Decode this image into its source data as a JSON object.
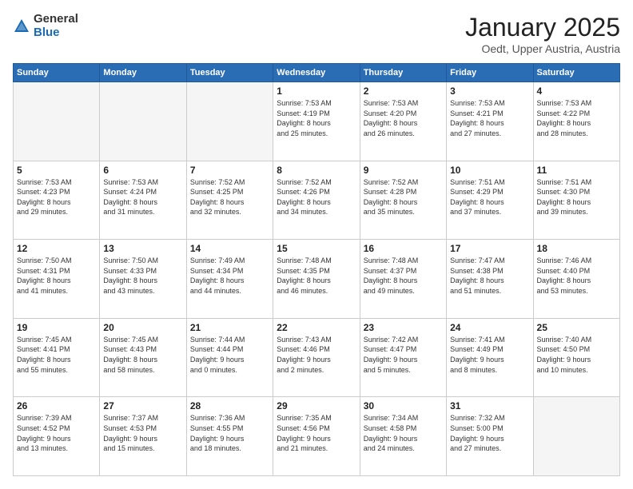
{
  "logo": {
    "general": "General",
    "blue": "Blue"
  },
  "header": {
    "month": "January 2025",
    "location": "Oedt, Upper Austria, Austria"
  },
  "days_header": [
    "Sunday",
    "Monday",
    "Tuesday",
    "Wednesday",
    "Thursday",
    "Friday",
    "Saturday"
  ],
  "weeks": [
    [
      {
        "day": "",
        "info": ""
      },
      {
        "day": "",
        "info": ""
      },
      {
        "day": "",
        "info": ""
      },
      {
        "day": "1",
        "info": "Sunrise: 7:53 AM\nSunset: 4:19 PM\nDaylight: 8 hours\nand 25 minutes."
      },
      {
        "day": "2",
        "info": "Sunrise: 7:53 AM\nSunset: 4:20 PM\nDaylight: 8 hours\nand 26 minutes."
      },
      {
        "day": "3",
        "info": "Sunrise: 7:53 AM\nSunset: 4:21 PM\nDaylight: 8 hours\nand 27 minutes."
      },
      {
        "day": "4",
        "info": "Sunrise: 7:53 AM\nSunset: 4:22 PM\nDaylight: 8 hours\nand 28 minutes."
      }
    ],
    [
      {
        "day": "5",
        "info": "Sunrise: 7:53 AM\nSunset: 4:23 PM\nDaylight: 8 hours\nand 29 minutes."
      },
      {
        "day": "6",
        "info": "Sunrise: 7:53 AM\nSunset: 4:24 PM\nDaylight: 8 hours\nand 31 minutes."
      },
      {
        "day": "7",
        "info": "Sunrise: 7:52 AM\nSunset: 4:25 PM\nDaylight: 8 hours\nand 32 minutes."
      },
      {
        "day": "8",
        "info": "Sunrise: 7:52 AM\nSunset: 4:26 PM\nDaylight: 8 hours\nand 34 minutes."
      },
      {
        "day": "9",
        "info": "Sunrise: 7:52 AM\nSunset: 4:28 PM\nDaylight: 8 hours\nand 35 minutes."
      },
      {
        "day": "10",
        "info": "Sunrise: 7:51 AM\nSunset: 4:29 PM\nDaylight: 8 hours\nand 37 minutes."
      },
      {
        "day": "11",
        "info": "Sunrise: 7:51 AM\nSunset: 4:30 PM\nDaylight: 8 hours\nand 39 minutes."
      }
    ],
    [
      {
        "day": "12",
        "info": "Sunrise: 7:50 AM\nSunset: 4:31 PM\nDaylight: 8 hours\nand 41 minutes."
      },
      {
        "day": "13",
        "info": "Sunrise: 7:50 AM\nSunset: 4:33 PM\nDaylight: 8 hours\nand 43 minutes."
      },
      {
        "day": "14",
        "info": "Sunrise: 7:49 AM\nSunset: 4:34 PM\nDaylight: 8 hours\nand 44 minutes."
      },
      {
        "day": "15",
        "info": "Sunrise: 7:48 AM\nSunset: 4:35 PM\nDaylight: 8 hours\nand 46 minutes."
      },
      {
        "day": "16",
        "info": "Sunrise: 7:48 AM\nSunset: 4:37 PM\nDaylight: 8 hours\nand 49 minutes."
      },
      {
        "day": "17",
        "info": "Sunrise: 7:47 AM\nSunset: 4:38 PM\nDaylight: 8 hours\nand 51 minutes."
      },
      {
        "day": "18",
        "info": "Sunrise: 7:46 AM\nSunset: 4:40 PM\nDaylight: 8 hours\nand 53 minutes."
      }
    ],
    [
      {
        "day": "19",
        "info": "Sunrise: 7:45 AM\nSunset: 4:41 PM\nDaylight: 8 hours\nand 55 minutes."
      },
      {
        "day": "20",
        "info": "Sunrise: 7:45 AM\nSunset: 4:43 PM\nDaylight: 8 hours\nand 58 minutes."
      },
      {
        "day": "21",
        "info": "Sunrise: 7:44 AM\nSunset: 4:44 PM\nDaylight: 9 hours\nand 0 minutes."
      },
      {
        "day": "22",
        "info": "Sunrise: 7:43 AM\nSunset: 4:46 PM\nDaylight: 9 hours\nand 2 minutes."
      },
      {
        "day": "23",
        "info": "Sunrise: 7:42 AM\nSunset: 4:47 PM\nDaylight: 9 hours\nand 5 minutes."
      },
      {
        "day": "24",
        "info": "Sunrise: 7:41 AM\nSunset: 4:49 PM\nDaylight: 9 hours\nand 8 minutes."
      },
      {
        "day": "25",
        "info": "Sunrise: 7:40 AM\nSunset: 4:50 PM\nDaylight: 9 hours\nand 10 minutes."
      }
    ],
    [
      {
        "day": "26",
        "info": "Sunrise: 7:39 AM\nSunset: 4:52 PM\nDaylight: 9 hours\nand 13 minutes."
      },
      {
        "day": "27",
        "info": "Sunrise: 7:37 AM\nSunset: 4:53 PM\nDaylight: 9 hours\nand 15 minutes."
      },
      {
        "day": "28",
        "info": "Sunrise: 7:36 AM\nSunset: 4:55 PM\nDaylight: 9 hours\nand 18 minutes."
      },
      {
        "day": "29",
        "info": "Sunrise: 7:35 AM\nSunset: 4:56 PM\nDaylight: 9 hours\nand 21 minutes."
      },
      {
        "day": "30",
        "info": "Sunrise: 7:34 AM\nSunset: 4:58 PM\nDaylight: 9 hours\nand 24 minutes."
      },
      {
        "day": "31",
        "info": "Sunrise: 7:32 AM\nSunset: 5:00 PM\nDaylight: 9 hours\nand 27 minutes."
      },
      {
        "day": "",
        "info": ""
      }
    ]
  ]
}
